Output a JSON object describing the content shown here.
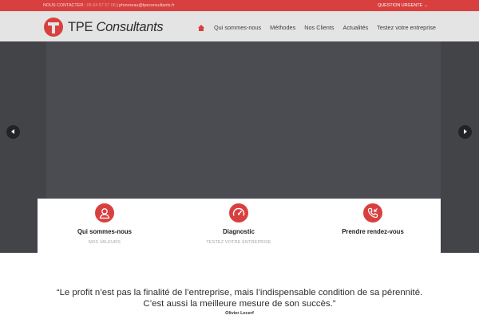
{
  "topbar": {
    "contact_label": "NOUS CONTACTER :",
    "phone": "06 64 57 57 06",
    "email": "phmoreau@tpeconsultants.fr",
    "urgent_link": "QUESTION URGENTE →"
  },
  "header": {
    "logo_brand": "TPE",
    "logo_suffix": "Consultants",
    "nav": [
      "Qui sommes-nous",
      "Méthodes",
      "Nos Clients",
      "Actualités",
      "Testez votre entreprise"
    ]
  },
  "services": [
    {
      "title": "Qui sommes-nous",
      "subtitle": "NOS VALEURS",
      "icon": "user-icon"
    },
    {
      "title": "Diagnostic",
      "subtitle": "TESTEZ VOTRE ENTREPRISE",
      "icon": "gauge-icon"
    },
    {
      "title": "Prendre rendez-vous",
      "subtitle": "",
      "icon": "phone-icon"
    }
  ],
  "quote": {
    "line1": "“Le profit n’est pas la finalité de l’entreprise, mais l’indispensable condition de sa pérennité.",
    "line2": "C’est aussi la meilleure mesure de son succès.”",
    "author": "Olivier Lecerf"
  },
  "colors": {
    "brand_red": "#d8403f",
    "hero_dark": "#434448"
  }
}
